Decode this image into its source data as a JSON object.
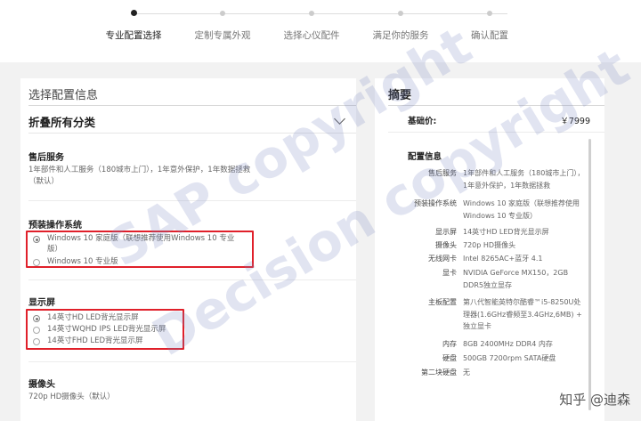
{
  "steps": [
    {
      "label": "专业配置选择",
      "active": true
    },
    {
      "label": "定制专属外观",
      "active": false
    },
    {
      "label": "选择心仪配件",
      "active": false
    },
    {
      "label": "满足你的服务",
      "active": false
    },
    {
      "label": "确认配置",
      "active": false
    }
  ],
  "left": {
    "title": "选择配置信息",
    "collapse_all": "折叠所有分类",
    "after_sales": {
      "title": "售后服务",
      "text": "1年部件和人工服务（180城市上门），1年意外保护，1年数据拯救（默认）"
    },
    "os": {
      "title": "预装操作系统",
      "options": [
        {
          "label": "Windows 10 家庭版（联想推荐使用Windows 10 专业版）",
          "selected": true
        },
        {
          "label": "Windows 10 专业版",
          "selected": false
        }
      ]
    },
    "display": {
      "title": "显示屏",
      "options": [
        {
          "label": "14英寸HD LED背光显示屏",
          "selected": true
        },
        {
          "label": "14英寸WQHD IPS LED背光显示屏",
          "selected": false
        },
        {
          "label": "14英寸FHD LED背光显示屏",
          "selected": false
        }
      ]
    },
    "camera": {
      "title": "摄像头",
      "text": "720p HD摄像头（默认）"
    },
    "highlight_color": "#e0202a"
  },
  "summary": {
    "title": "摘要",
    "base_price_label": "基础价:",
    "base_price": "￥7999",
    "config_title": "配置信息",
    "rows": [
      {
        "key": "售后服务",
        "value": "1年部件和人工服务（180城市上门），1年意外保护，1年数据拯救"
      },
      {
        "key": "预装操作系统",
        "value": "Windows 10 家庭版（联想推荐使用Windows 10 专业版）"
      },
      {
        "key": "显示屏",
        "value": "14英寸HD LED背光显示屏"
      },
      {
        "key": "摄像头",
        "value": "720p HD摄像头"
      },
      {
        "key": "无线网卡",
        "value": "Intel 8265AC+蓝牙 4.1"
      },
      {
        "key": "显卡",
        "value": "NVIDIA GeForce MX150，2GB DDR5独立显存"
      },
      {
        "key": "主板配置",
        "value": "第八代智能英特尔酷睿™i5-8250U处理器(1.6GHz睿频至3.4GHz,6MB) + 独立显卡"
      },
      {
        "key": "内存",
        "value": "8GB 2400MHz DDR4 内存"
      },
      {
        "key": "硬盘",
        "value": "500GB 7200rpm SATA硬盘"
      },
      {
        "key": "第二块硬盘",
        "value": "无"
      }
    ]
  },
  "watermark": {
    "line1": "SAP copyright",
    "line2": "Decision copyright"
  },
  "attribution": "知乎 @迪森"
}
